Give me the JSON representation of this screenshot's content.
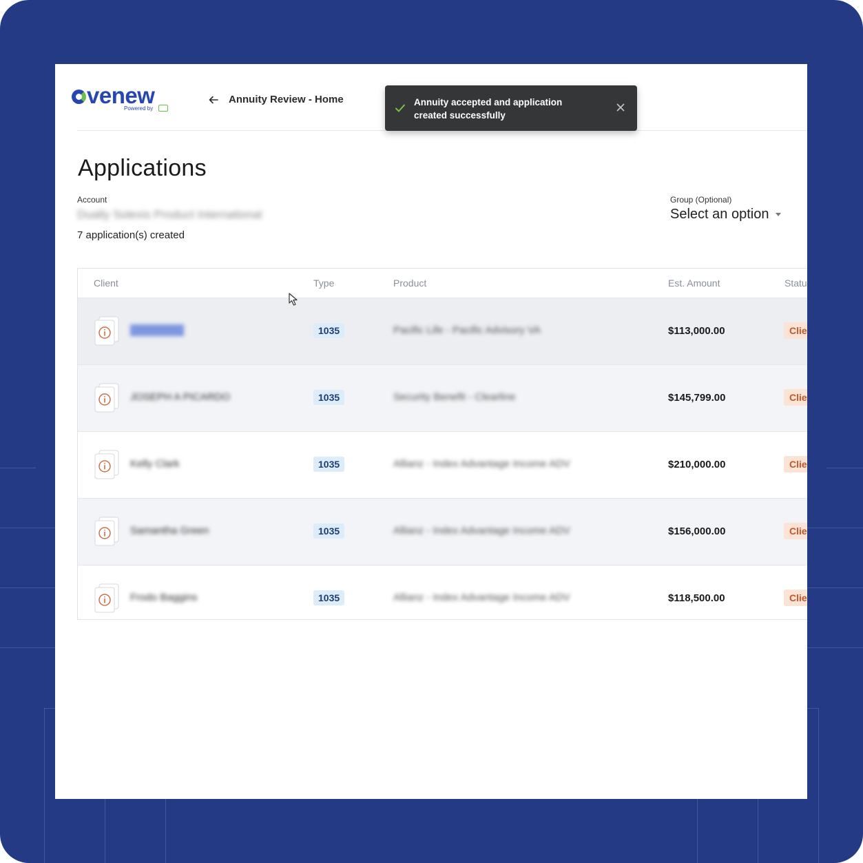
{
  "header": {
    "logo_text": "venew",
    "logo_powered": "Powered by",
    "back_label": "Annuity Review - Home"
  },
  "toast": {
    "message": "Annuity accepted and application created successfully",
    "icon": "check-icon",
    "close_icon": "close-icon"
  },
  "page": {
    "title": "Applications",
    "account_label": "Account",
    "account_value": "Dually Solexis Product International",
    "apps_created": "7 application(s) created",
    "group_label": "Group (Optional)",
    "group_value": "Select an option"
  },
  "table": {
    "columns": [
      "Client",
      "Type",
      "Product",
      "Est. Amount",
      "Statu"
    ],
    "rows": [
      {
        "client": "JOHN DOE",
        "type": "1035",
        "product": "Pacific Life - Pacific Advisory VA",
        "amount": "$113,000.00",
        "status": "Clie"
      },
      {
        "client": "JOSEPH A PICARDO",
        "type": "1035",
        "product": "Security Benefit - Clearline",
        "amount": "$145,799.00",
        "status": "Clie"
      },
      {
        "client": "Kelly Clark",
        "type": "1035",
        "product": "Allianz - Index Advantage Income ADV",
        "amount": "$210,000.00",
        "status": "Clie"
      },
      {
        "client": "Samantha Green",
        "type": "1035",
        "product": "Allianz - Index Advantage Income ADV",
        "amount": "$156,000.00",
        "status": "Clie"
      },
      {
        "client": "Frodo Baggins",
        "type": "1035",
        "product": "Allianz - Index Advantage Income ADV",
        "amount": "$118,500.00",
        "status": "Clie"
      }
    ]
  },
  "colors": {
    "frame": "#253a85",
    "brand_blue": "#2747b0",
    "brand_green": "#6cc04a",
    "type_badge_bg": "#dcecf9",
    "status_badge_bg": "#fbe3d6"
  }
}
